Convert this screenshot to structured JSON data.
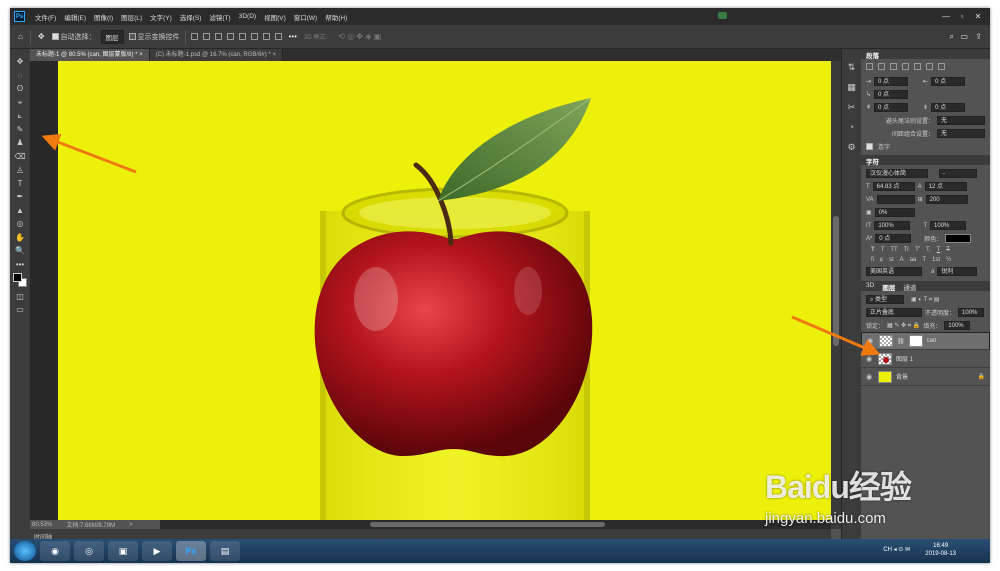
{
  "menubar": {
    "logo": "Ps",
    "items": [
      "文件(F)",
      "编辑(E)",
      "图像(I)",
      "图层(L)",
      "文字(Y)",
      "选择(S)",
      "滤镜(T)",
      "3D(D)",
      "视图(V)",
      "窗口(W)",
      "帮助(H)"
    ],
    "window_controls": [
      "—",
      "▫",
      "✕"
    ]
  },
  "options": {
    "home_icon": "⌂",
    "move_icon": "✥",
    "auto_select_label": "自动选择：",
    "auto_select_value": "图层",
    "show_transform_label": "显示变换控件",
    "mode_3d_label": "3D 模式：",
    "more": "•••"
  },
  "tabs": [
    {
      "label": "未标题-1 @ 80.5% (can, 图层蒙版/8) *",
      "close": "×"
    },
    {
      "label": "(C) 未标题-1.psd @ 16.7% (can, RGB/8#) *",
      "close": "×"
    }
  ],
  "tools": [
    "✥",
    "◌",
    "ʘ",
    "⌖",
    "⟀",
    "✎",
    "♟",
    "⌫",
    "◬",
    "T",
    "✒",
    "▲",
    "◎",
    "✋",
    "🔍",
    "•••"
  ],
  "status": {
    "zoom": "80.53%",
    "doc": "文档:7.66M/8.78M",
    "arrow": ">"
  },
  "timeline_label": "时间轴",
  "right_icons": [
    "⇅",
    "▦",
    "✂",
    "◔",
    "⚙"
  ],
  "paragraph_panel": {
    "title": "段落",
    "fields": [
      {
        "a": "0 点",
        "b": "0 点"
      },
      {
        "a": "0 点"
      },
      {
        "a": "0 点",
        "b": "0 点"
      }
    ],
    "avoid_label": "避头尾法则设置：",
    "avoid_value": "无",
    "spacing_label": "间距组合设置：",
    "spacing_value": "无",
    "hyphen_label": "连字"
  },
  "character_panel": {
    "title": "字符",
    "font": "汉仪漫心体简",
    "style": "-",
    "size": "64.83 点",
    "leading": "12 点",
    "kerning": "",
    "tracking": "200",
    "scale_pct": "0%",
    "v_scale": "100%",
    "h_scale": "100%",
    "baseline": "0 点",
    "color_label": "颜色：",
    "language": "美国英语",
    "aa": "锐利",
    "glyphs": [
      "T",
      "T",
      "TT",
      "Tr",
      "T'",
      "T,",
      "T",
      "T"
    ],
    "glyphs2": [
      "fi",
      "ɕ",
      "st",
      "A",
      "aa",
      "T",
      "1st",
      "½"
    ]
  },
  "layers_panel": {
    "tabs": [
      "3D",
      "图层",
      "通道"
    ],
    "active_tab": "图层",
    "kind_label": "类型",
    "blend_mode": "正片叠底",
    "opacity_label": "不透明度：",
    "opacity": "100%",
    "lock_label": "锁定：",
    "fill_label": "填充：",
    "fill": "100%",
    "layers": [
      {
        "name": "can",
        "selected": true
      },
      {
        "name": "图层 1",
        "selected": false
      },
      {
        "name": "背景",
        "selected": false,
        "locked": "🔒"
      }
    ]
  },
  "taskbar": {
    "apps": [
      "◉",
      "◎",
      "▣",
      "▶",
      "Ps",
      "▤"
    ],
    "time": "16:49",
    "date": "2019-08-13",
    "tray": "CH ◂ ⊙ ✉"
  },
  "watermark": {
    "brand": "Bai",
    "paw": "du",
    "cn": "经验",
    "url": "jingyan.baidu.com"
  },
  "colors": {
    "canvas": "#ecf00a",
    "accent_arrow": "#f07a10",
    "apple_red": "#b3141c",
    "leaf": "#4b7a32"
  }
}
